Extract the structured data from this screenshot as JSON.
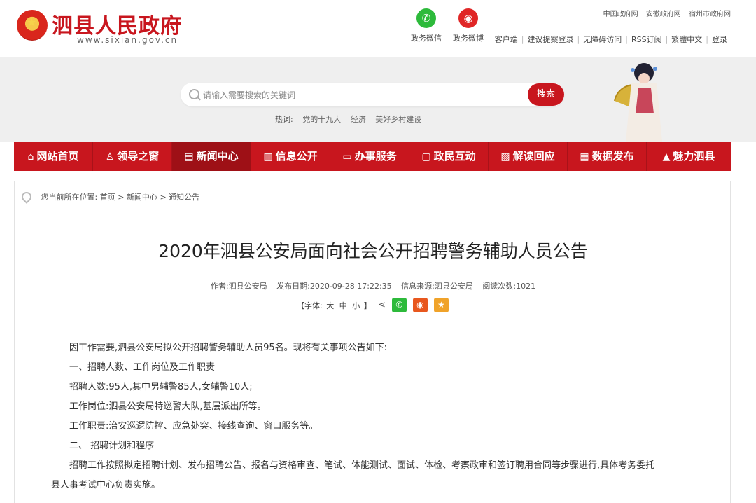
{
  "header": {
    "site_title": "泗县人民政府",
    "site_url": "www.sixian.gov.cn",
    "social": [
      {
        "label": "政务微信",
        "icon": "wechat-icon"
      },
      {
        "label": "政务微博",
        "icon": "weibo-icon"
      }
    ],
    "gov_links": [
      "中国政府网",
      "安徽政府网",
      "宿州市政府网"
    ],
    "util_links": [
      "客户端",
      "建议提案登录",
      "无障碍访问",
      "RSS订阅",
      "繁體中文",
      "登录"
    ]
  },
  "search": {
    "placeholder": "请输入需要搜索的关键词",
    "button_label": "搜索",
    "hot_label": "热词:",
    "hot_words": [
      "党的十九大",
      "经济",
      "美好乡村建设"
    ]
  },
  "nav": {
    "items": [
      {
        "label": "网站首页",
        "icon": "home-icon",
        "glyph": "⌂"
      },
      {
        "label": "领导之窗",
        "icon": "user-icon",
        "glyph": "♙"
      },
      {
        "label": "新闻中心",
        "icon": "newspaper-icon",
        "glyph": "▤"
      },
      {
        "label": "信息公开",
        "icon": "document-icon",
        "glyph": "▥"
      },
      {
        "label": "办事服务",
        "icon": "monitor-icon",
        "glyph": "▭"
      },
      {
        "label": "政民互动",
        "icon": "chat-icon",
        "glyph": "▢"
      },
      {
        "label": "解读回应",
        "icon": "edit-icon",
        "glyph": "▧"
      },
      {
        "label": "数据发布",
        "icon": "chart-icon",
        "glyph": "▦"
      },
      {
        "label": "魅力泗县",
        "icon": "mountain-icon",
        "glyph": "▲"
      }
    ],
    "active_index": 2
  },
  "breadcrumb": {
    "prefix": "您当前所在位置:",
    "items": [
      "首页",
      "新闻中心",
      "通知公告"
    ],
    "separator": ">"
  },
  "article": {
    "title": "2020年泗县公安局面向社会公开招聘警务辅助人员公告",
    "meta": {
      "author": "作者:泗县公安局",
      "date": "发布日期:2020-09-28 17:22:35",
      "source": "信息来源:泗县公安局",
      "views": "阅读次数:1021"
    },
    "font_label_open": "【字体:",
    "font_large": "大",
    "font_medium": "中",
    "font_small": "小",
    "font_label_close": "】",
    "share_glyph": "⋖",
    "paragraphs": [
      "因工作需要,泗县公安局拟公开招聘警务辅助人员95名。现将有关事项公告如下:",
      "一、招聘人数、工作岗位及工作职责",
      "招聘人数:95人,其中男辅警85人,女辅警10人;",
      "工作岗位:泗县公安局特巡警大队,基层派出所等。",
      "工作职责:治安巡逻防控、应急处突、接线查询、窗口服务等。",
      "二、 招聘计划和程序",
      "招聘工作按照拟定招聘计划、发布招聘公告、报名与资格审查、笔试、体能测试、面试、体检、考察政审和签订聘用合同等步骤进行,具体考务委托",
      "县人事考试中心负责实施。"
    ]
  },
  "colors": {
    "brand_red": "#c8161e",
    "nav_active": "#9e1016",
    "wechat_green": "#2dba3b",
    "weibo_orange": "#e8571e",
    "favorite_yellow": "#f0a32a"
  }
}
